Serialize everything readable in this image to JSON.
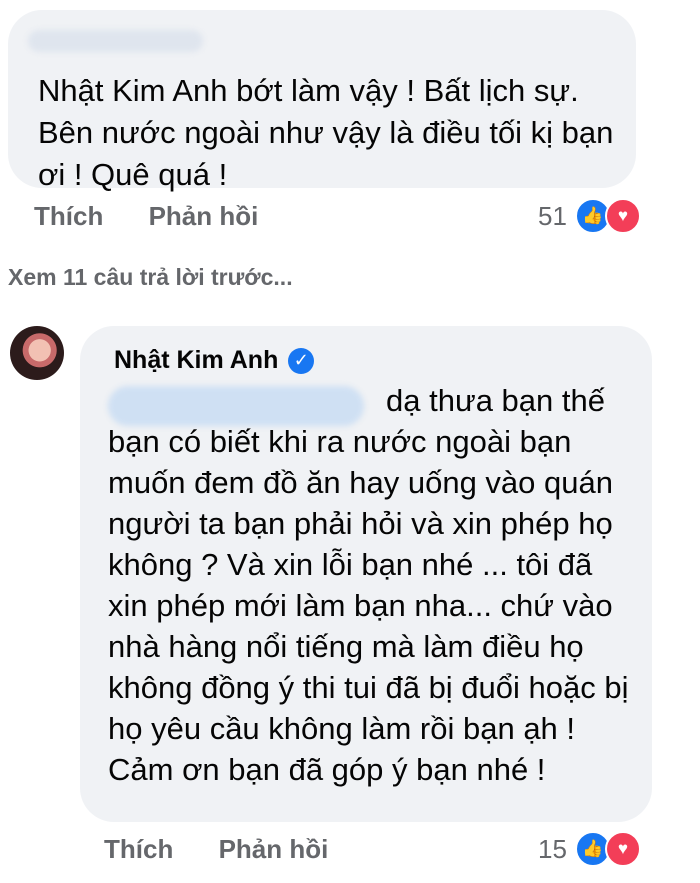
{
  "comment1": {
    "text": "Nhật Kim Anh bớt làm vậy ! Bất lịch sự. Bên nước ngoài như vậy là điều tối kị bạn ơi ! Quê quá !",
    "actions": {
      "like": "Thích",
      "reply": "Phản hồi"
    },
    "reaction_count": "51"
  },
  "view_more": "Xem 11 câu trả lời trước...",
  "comment2": {
    "author": "Nhật Kim Anh",
    "text": "dạ thưa bạn thế bạn có biết khi ra nước ngoài bạn muốn đem đồ ăn hay uống vào quán người ta bạn phải hỏi và xin phép họ không ? Và xin lỗi bạn nhé ... tôi đã xin phép mới làm bạn nha... chứ vào nhà hàng nổi tiếng mà làm điều  họ không đồng ý thi tui đã bị đuổi hoặc bị họ yêu cầu không làm rồi bạn ạh ! Cảm ơn bạn đã góp ý bạn nhé !",
    "actions": {
      "like": "Thích",
      "reply": "Phản hồi"
    },
    "reaction_count": "15"
  }
}
